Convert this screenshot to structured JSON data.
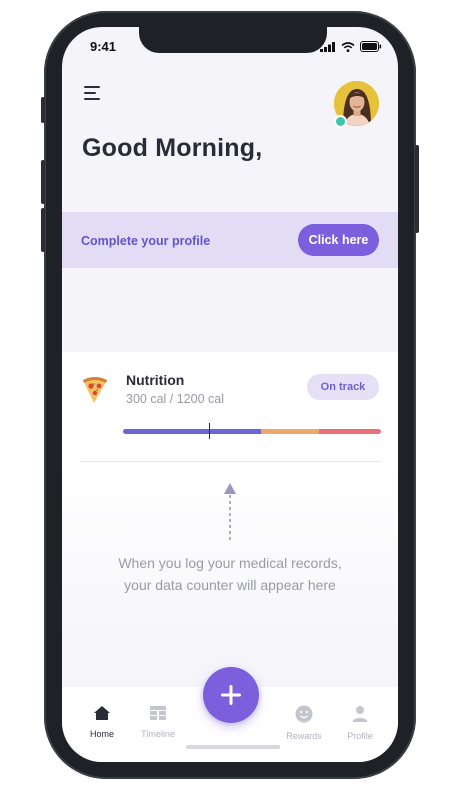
{
  "status_bar": {
    "time": "9:41"
  },
  "header": {
    "greeting": "Good Morning,"
  },
  "profile_banner": {
    "text": "Complete your profile",
    "button_label": "Click here"
  },
  "nutrition": {
    "title": "Nutrition",
    "calories": "300 cal / 1200 cal",
    "status": "On track",
    "bar_colors": [
      "#6f63d8",
      "#f0a867",
      "#e9727a"
    ]
  },
  "empty_state": {
    "message": "When you log your medical records, your data counter will appear here"
  },
  "tabbar": {
    "tabs": [
      {
        "label": "Home",
        "icon": "home-icon",
        "active": true
      },
      {
        "label": "Timeline",
        "icon": "grid-list-icon",
        "active": false
      },
      {
        "label": "Rewards",
        "icon": "smiley-icon",
        "active": false
      },
      {
        "label": "Profile",
        "icon": "user-icon",
        "active": false
      }
    ],
    "add_icon": "plus-icon"
  },
  "colors": {
    "accent": "#7b5fdc",
    "online": "#3cc6a8",
    "background": "#f4f4f9"
  }
}
